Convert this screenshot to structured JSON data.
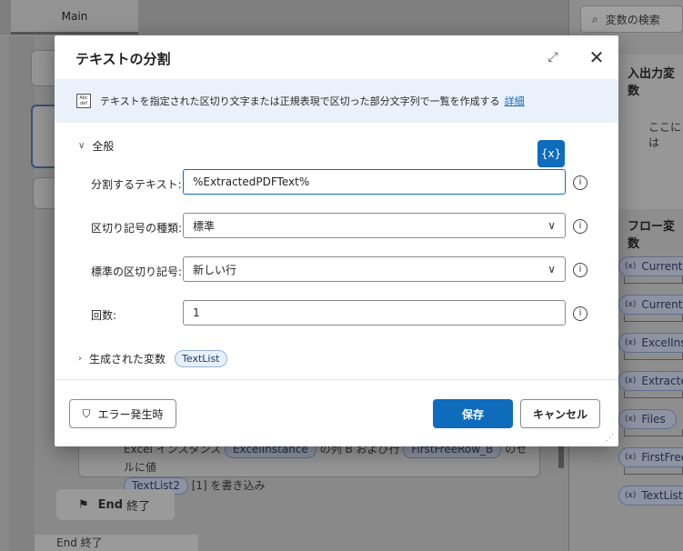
{
  "background": {
    "tab_main": "Main",
    "step_text_line1_pre": "Excel インスタンス",
    "step_chip_instance": "ExcelInstance",
    "step_text_line1_mid": "の列",
    "step_text_line1_col": "B",
    "step_text_line1_mid2": "および行",
    "step_chip_row": "FirstFreeRow_B",
    "step_text_line1_post": "のセルに値",
    "step_chip_list": "TextList2",
    "step_text_line2": "[1] を書き込み",
    "end_label": "End",
    "end_suffix": "終了",
    "end2_label": "End 終了"
  },
  "right_panel": {
    "search_placeholder": "変数の検索",
    "io_section": "入出力変数",
    "io_empty": "ここには",
    "flow_section": "フロー変数",
    "variables": [
      "CurrentIt",
      "CurrentIt",
      "ExcelInst",
      "Extracted",
      "Files",
      "FirstFree",
      "TextList"
    ]
  },
  "dialog": {
    "title": "テキストの分割",
    "info_icon_text": "Abc def",
    "info_text": "テキストを指定された区切り文字または正規表現で区切った部分文字列で一覧を作成する",
    "info_link": "詳細",
    "section_general": "全般",
    "fx_label": "{x}",
    "fields": {
      "text_label": "分割するテキスト:",
      "text_value": "%ExtractedPDFText%",
      "delim_type_label": "区切り記号の種類:",
      "delim_type_value": "標準",
      "std_delim_label": "標準の区切り記号:",
      "std_delim_value": "新しい行",
      "times_label": "回数:",
      "times_value": "1"
    },
    "produced_label": "生成された変数",
    "produced_var": "TextList",
    "on_error_label": "エラー発生時",
    "save_label": "保存",
    "cancel_label": "キャンセル"
  },
  "colors": {
    "accent": "#0f6cbd",
    "info_bg": "#eaf1fb",
    "overlay": "#8a8a8a"
  }
}
